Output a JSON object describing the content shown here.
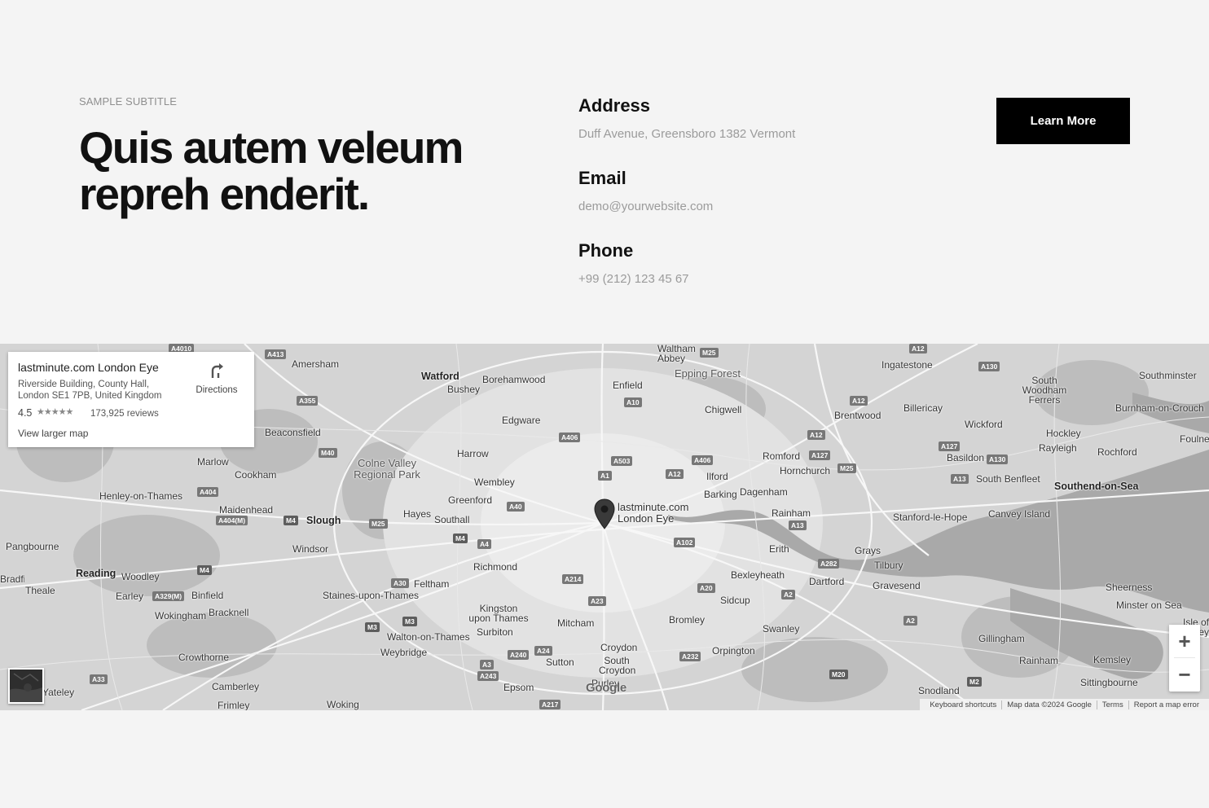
{
  "section": {
    "subtitle": "SAMPLE SUBTITLE",
    "heading": "Quis autem veleum repreh enderit.",
    "button": "Learn More"
  },
  "contact": {
    "address": {
      "label": "Address",
      "value": "Duff Avenue, Greensboro 1382 Vermont"
    },
    "email": {
      "label": "Email",
      "value": "demo@yourwebsite.com"
    },
    "phone": {
      "label": "Phone",
      "value": "+99 (212) 123 45 67"
    }
  },
  "map": {
    "place_card": {
      "title": "lastminute.com London Eye",
      "address": "Riverside Building, County Hall, London SE1 7PB, United Kingdom",
      "rating": "4.5",
      "stars": "★★★★★",
      "reviews": "173,925 reviews",
      "larger_map": "View larger map",
      "directions": "Directions"
    },
    "pin_label_line1": "lastminute.com",
    "pin_label_line2": "London Eye",
    "google_logo": "Google",
    "attribution": {
      "shortcuts": "Keyboard shortcuts",
      "data": "Map data ©2024 Google",
      "terms": "Terms",
      "report": "Report a map error"
    },
    "zoom_in": "+",
    "zoom_out": "−",
    "places": [
      "Amersham",
      "Watford",
      "Borehamwood",
      "Enfield",
      "Waltham Abbey",
      "Epping Forest",
      "Ingatestone",
      "South Woodham Ferrers",
      "Southminster",
      "Bushey",
      "Chigwell",
      "Brentwood",
      "Billericay",
      "Burnham-on-Crouch",
      "Beaconsfield",
      "Edgware",
      "Wickford",
      "Hockley",
      "Foulness Island",
      "Marlow",
      "Colne Valley Regional Park",
      "Harrow",
      "Romford",
      "Basildon",
      "Rayleigh",
      "Rochford",
      "Cookham",
      "Wembley",
      "Ilford",
      "Hornchurch",
      "South Benfleet",
      "Southend-on-Sea",
      "Henley-on-Thames",
      "Greenford",
      "Barking",
      "Dagenham",
      "Maidenhead",
      "Slough",
      "Hayes",
      "Southall",
      "Rainham",
      "Stanford-le-Hope",
      "Canvey Island",
      "Pangbourne",
      "Windsor",
      "Erith",
      "Grays",
      "Tilbury",
      "Reading",
      "Woodley",
      "Richmond",
      "Bexleyheath",
      "Dartford",
      "Gravesend",
      "Sheerness",
      "Theale",
      "Earley",
      "Binfield",
      "Feltham",
      "Sidcup",
      "Minster on Sea",
      "Staines-upon-Thames",
      "Wokingham",
      "Bracknell",
      "Kingston upon Thames",
      "Mitcham",
      "Bromley",
      "Swanley",
      "Isle of Sheppey",
      "Surbiton",
      "Walton-on-Thames",
      "Gillingham",
      "Weybridge",
      "Croydon",
      "Orpington",
      "Rainham",
      "Kemsley",
      "Crowthorne",
      "Sutton",
      "South Croydon",
      "Sittingbourne",
      "Purley",
      "Camberley",
      "Epsom",
      "Snodland",
      "Frimley",
      "Woking",
      "Yateley",
      "Bradfield"
    ]
  }
}
